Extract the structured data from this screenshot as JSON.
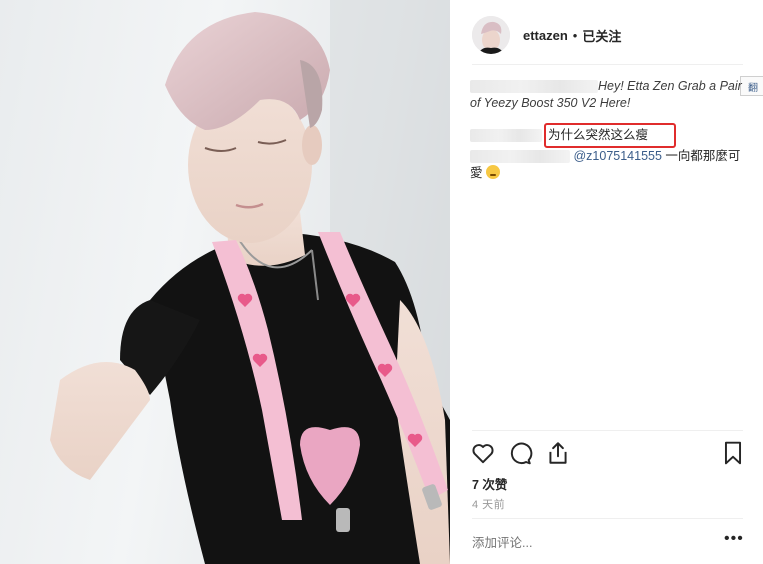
{
  "header": {
    "username": "ettazen",
    "separator": "•",
    "follow_status": "已关注"
  },
  "comments": [
    {
      "author_blurred": true,
      "text_line1": "Hey! Etta Zen Grab a Pair",
      "text_line2": "of Yeezy Boost 350 V2 Here!"
    },
    {
      "author_blurred": true,
      "text": "为什么突然这么瘦",
      "highlighted": true
    },
    {
      "author_blurred": true,
      "mention": "@z1075141555",
      "text_tail": " 一向都那麼可",
      "text_line2": "愛"
    }
  ],
  "edge_badge": "翻",
  "actions": {
    "like_icon": "heart-icon",
    "comment_icon": "comment-icon",
    "share_icon": "share-icon",
    "save_icon": "bookmark-icon"
  },
  "likes_text": "7 次赞",
  "time_text": "4 天前",
  "add_comment_placeholder": "添加评论...",
  "more_options": "•••",
  "colors": {
    "highlight_border": "#e02c2c",
    "mention": "#3b5d8a",
    "secondary_text": "#999999"
  }
}
